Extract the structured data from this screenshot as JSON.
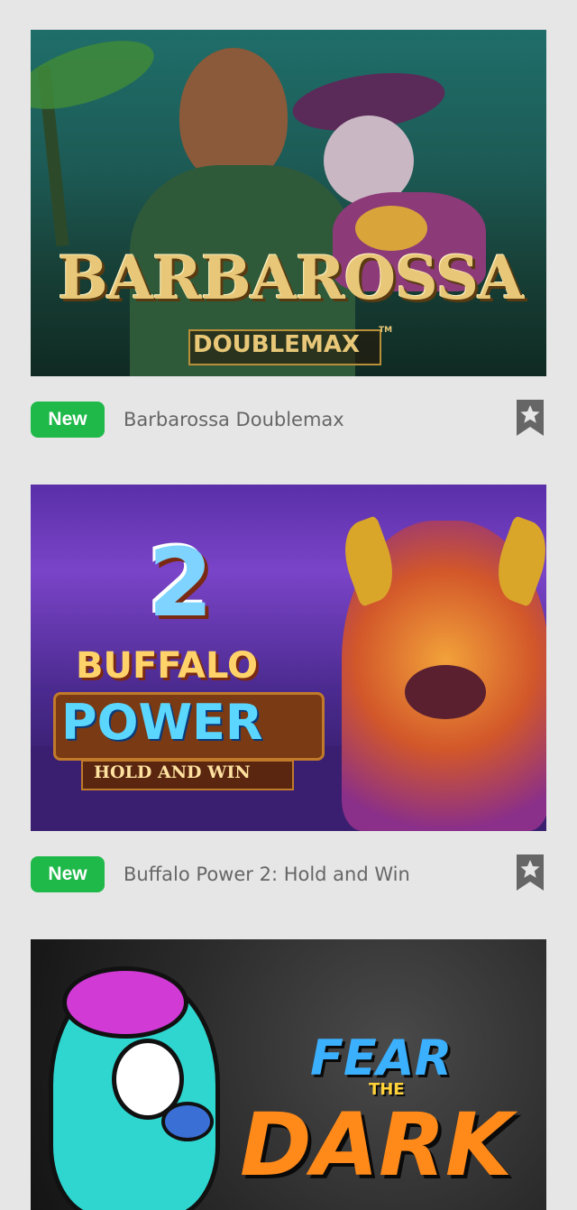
{
  "games": [
    {
      "badge": "New",
      "title": "Barbarossa Doublemax",
      "art": {
        "line1": "BARBAROSSA",
        "line2": "DOUBLEMAX",
        "tm": "TM"
      },
      "bookmark_icon": "bookmark-star-icon"
    },
    {
      "badge": "New",
      "title": "Buffalo Power 2: Hold and Win",
      "art": {
        "number": "2",
        "line1": "BUFFALO",
        "line2": "POWER",
        "line3": "HOLD AND WIN"
      },
      "bookmark_icon": "bookmark-star-icon"
    },
    {
      "art": {
        "line1": "FEAR",
        "line2": "THE",
        "line3": "DARK"
      }
    }
  ],
  "colors": {
    "background": "#e6e6e6",
    "badge": "#1fb94a",
    "title_text": "#666666",
    "bookmark": "#666666"
  }
}
